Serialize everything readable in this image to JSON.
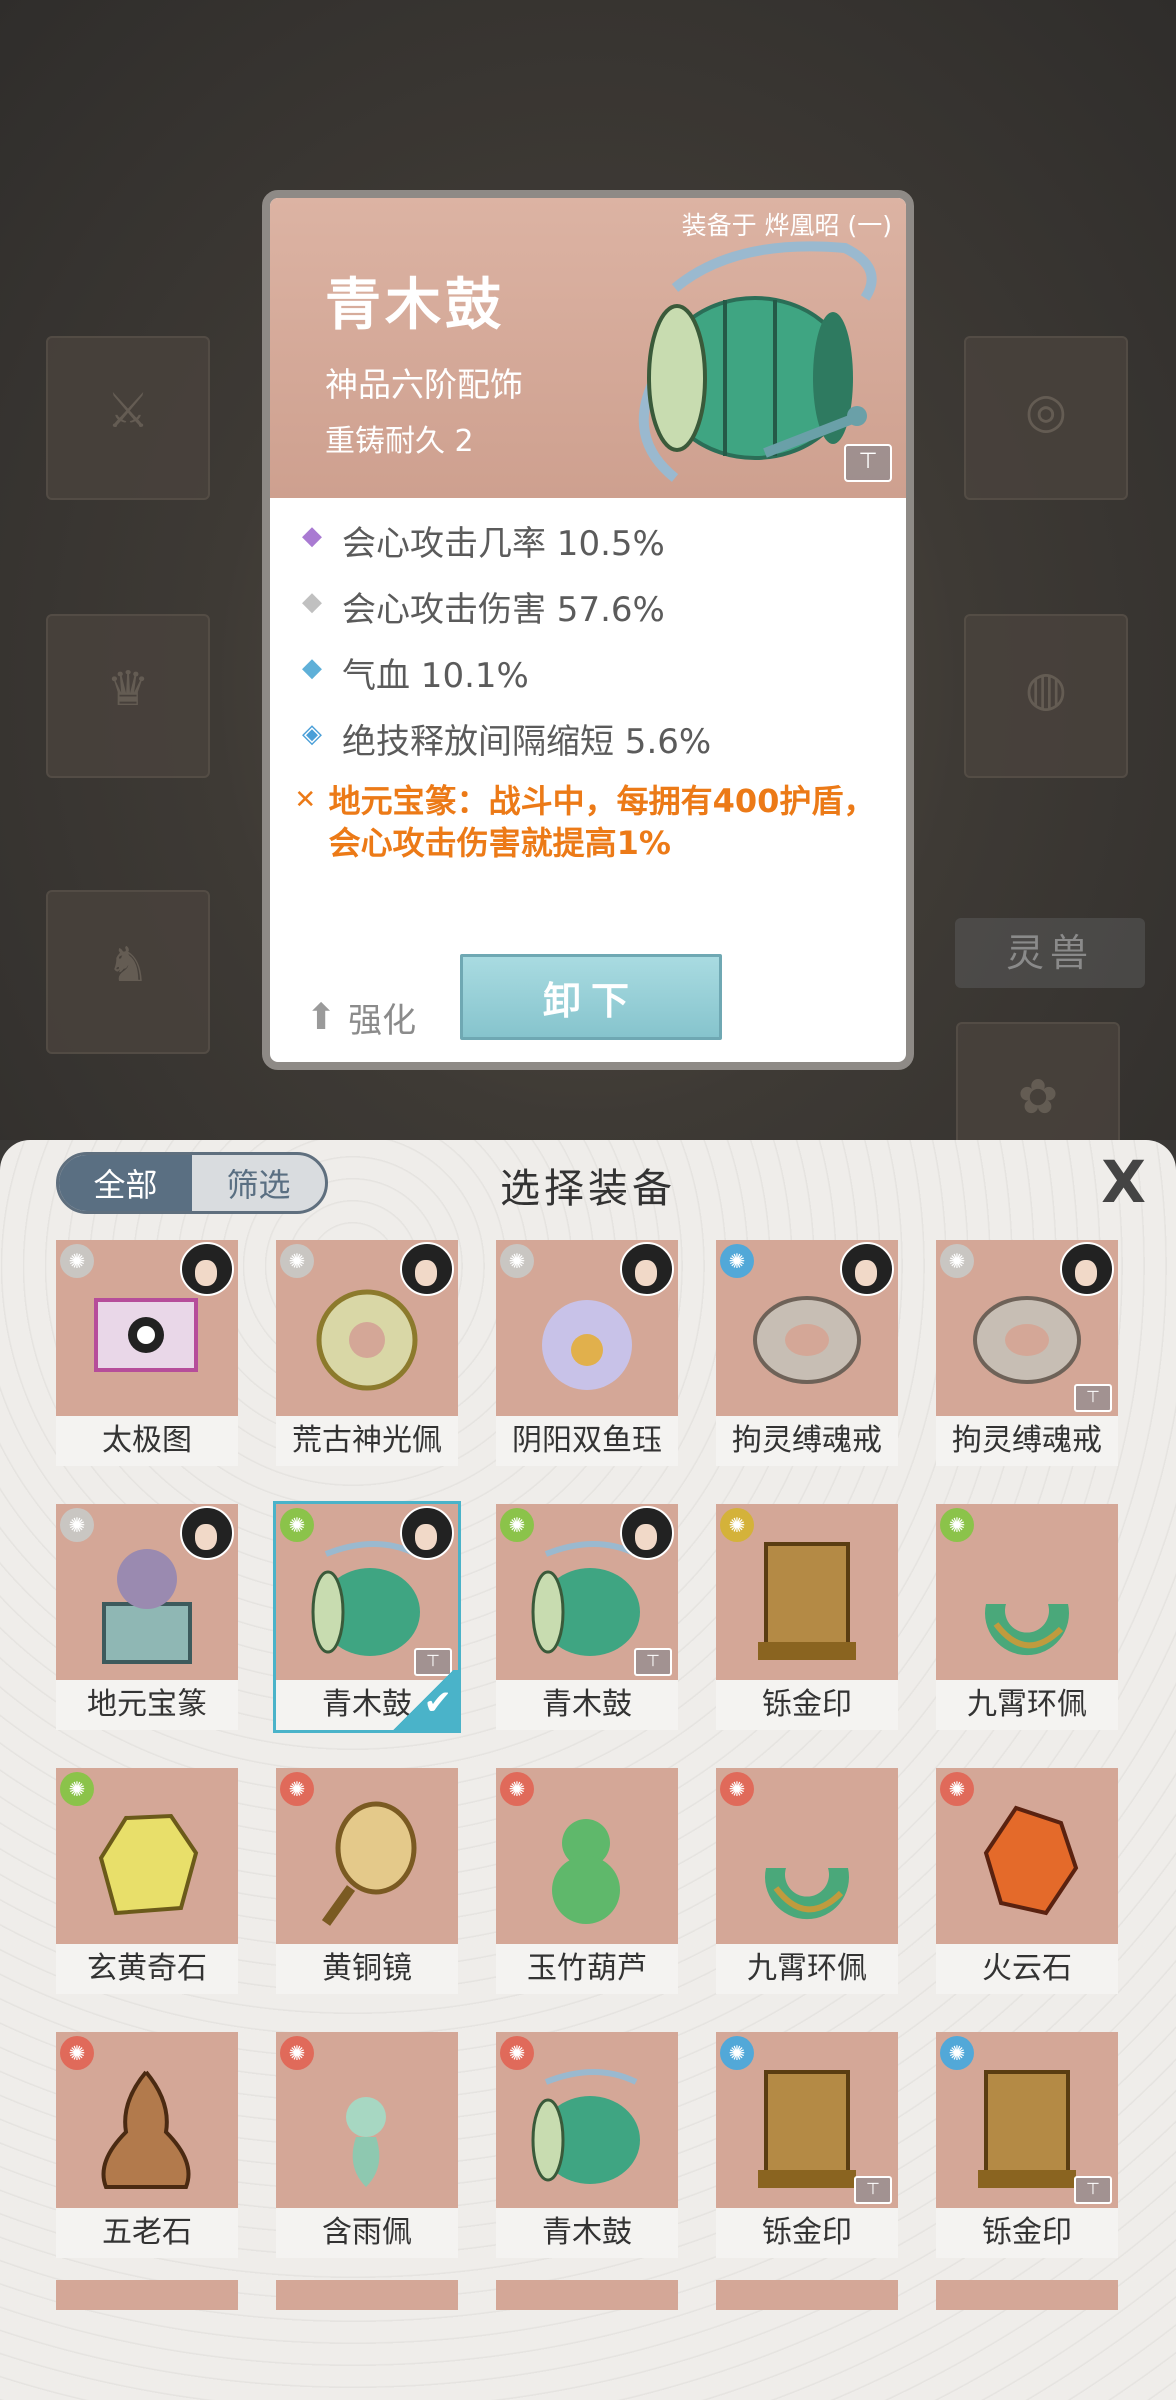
{
  "background": {
    "side_button": "灵兽"
  },
  "detail": {
    "equipped_on": "装备于 烨凰昭 (一)",
    "name": "青木鼓",
    "grade": "神品六阶配饰",
    "durability": "重铸耐久 2",
    "stats": [
      {
        "icon": "diamond-purple",
        "text": "会心攻击几率 10.5%"
      },
      {
        "icon": "diamond-gray",
        "text": "会心攻击伤害 57.6%"
      },
      {
        "icon": "diamond-blue",
        "text": "气血 10.1%"
      },
      {
        "icon": "drop-blue",
        "text": "绝技释放间隔缩短 5.6%"
      }
    ],
    "special": "地元宝篆：战斗中，每拥有400护盾，会心攻击伤害就提高1%",
    "strengthen_label": "强化",
    "unequip_label": "卸下"
  },
  "panel": {
    "tab_all": "全部",
    "tab_filter": "筛选",
    "title": "选择装备",
    "close_label": "X",
    "items": [
      {
        "name": "太极图",
        "sym": "white",
        "avatar": true,
        "lock": false,
        "selected": false,
        "art": "scroll"
      },
      {
        "name": "荒古神光佩",
        "sym": "white",
        "avatar": true,
        "lock": false,
        "selected": false,
        "art": "pendant"
      },
      {
        "name": "阴阳双鱼珏",
        "sym": "white",
        "avatar": true,
        "lock": false,
        "selected": false,
        "art": "orb"
      },
      {
        "name": "拘灵缚魂戒",
        "sym": "blue",
        "avatar": true,
        "lock": false,
        "selected": false,
        "art": "ring"
      },
      {
        "name": "拘灵缚魂戒",
        "sym": "white",
        "avatar": true,
        "lock": true,
        "selected": false,
        "art": "ring"
      },
      {
        "name": "地元宝篆",
        "sym": "white",
        "avatar": true,
        "lock": false,
        "selected": false,
        "art": "seal"
      },
      {
        "name": "青木鼓",
        "sym": "green",
        "avatar": true,
        "lock": true,
        "selected": true,
        "art": "drum"
      },
      {
        "name": "青木鼓",
        "sym": "green",
        "avatar": true,
        "lock": true,
        "selected": false,
        "art": "drum"
      },
      {
        "name": "铄金印",
        "sym": "yellow",
        "avatar": false,
        "lock": false,
        "selected": false,
        "art": "box"
      },
      {
        "name": "九霄环佩",
        "sym": "green",
        "avatar": false,
        "lock": false,
        "selected": false,
        "art": "jade"
      },
      {
        "name": "玄黄奇石",
        "sym": "green",
        "avatar": false,
        "lock": false,
        "selected": false,
        "art": "stone"
      },
      {
        "name": "黄铜镜",
        "sym": "red",
        "avatar": false,
        "lock": false,
        "selected": false,
        "art": "mirror"
      },
      {
        "name": "玉竹葫芦",
        "sym": "red",
        "avatar": false,
        "lock": false,
        "selected": false,
        "art": "gourd"
      },
      {
        "name": "九霄环佩",
        "sym": "red",
        "avatar": false,
        "lock": false,
        "selected": false,
        "art": "jade"
      },
      {
        "name": "火云石",
        "sym": "red",
        "avatar": false,
        "lock": false,
        "selected": false,
        "art": "fire"
      },
      {
        "name": "五老石",
        "sym": "red",
        "avatar": false,
        "lock": false,
        "selected": false,
        "art": "rock"
      },
      {
        "name": "含雨佩",
        "sym": "red",
        "avatar": false,
        "lock": false,
        "selected": false,
        "art": "charm"
      },
      {
        "name": "青木鼓",
        "sym": "red",
        "avatar": false,
        "lock": false,
        "selected": false,
        "art": "drum"
      },
      {
        "name": "铄金印",
        "sym": "blue",
        "avatar": false,
        "lock": true,
        "selected": false,
        "art": "box"
      },
      {
        "name": "铄金印",
        "sym": "blue",
        "avatar": false,
        "lock": true,
        "selected": false,
        "art": "box"
      }
    ]
  },
  "colors": {
    "special": "#ec7a17",
    "selected_outline": "#4ab3c9",
    "tab_active": "#5a6f82"
  }
}
